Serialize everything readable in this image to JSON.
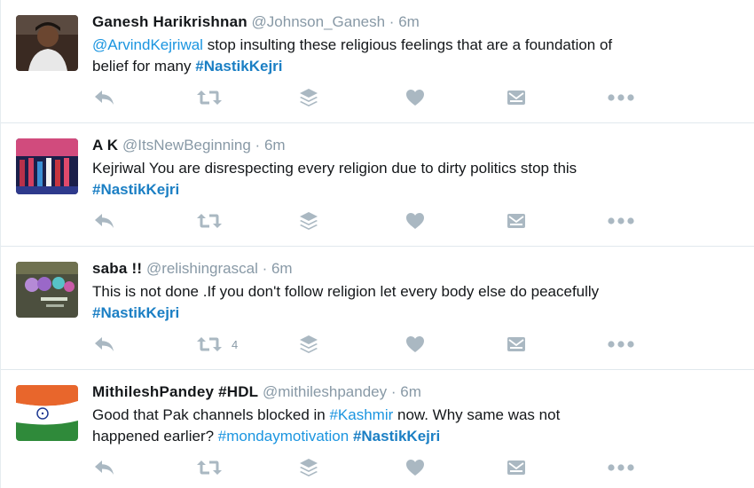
{
  "tweets": [
    {
      "name": "Ganesh Harikrishnan",
      "handle": "@Johnson_Ganesh",
      "time": "6m",
      "line1": [
        {
          "text": "@ArvindKejriwal",
          "type": "mention"
        },
        {
          "text": " stop insulting these religious feelings that are a foundation of",
          "type": "plain"
        }
      ],
      "line2": [
        {
          "text": "belief for many ",
          "type": "plain"
        },
        {
          "text": "#NastikKejri",
          "type": "hashtag-strong"
        }
      ],
      "retweet_count": ""
    },
    {
      "name": "A K",
      "handle": "@ItsNewBeginning",
      "time": "6m",
      "line1": [
        {
          "text": "Kejriwal You are disrespecting every religion due to dirty politics stop this",
          "type": "plain"
        }
      ],
      "line2": [
        {
          "text": "#NastikKejri",
          "type": "hashtag-strong"
        }
      ],
      "retweet_count": ""
    },
    {
      "name": "saba !!",
      "handle": "@relishingrascal",
      "time": "6m",
      "line1": [
        {
          "text": "This is not done .If you don't follow religion let every body else do peacefully",
          "type": "plain"
        }
      ],
      "line2": [
        {
          "text": "#NastikKejri",
          "type": "hashtag-strong"
        }
      ],
      "retweet_count": "4"
    },
    {
      "name": "MithileshPandey #HDL",
      "handle": "@mithileshpandey",
      "time": "6m",
      "line1": [
        {
          "text": "Good that Pak channels blocked in ",
          "type": "plain"
        },
        {
          "text": "#Kashmir",
          "type": "hashtag"
        },
        {
          "text": " now. Why same was not",
          "type": "plain"
        }
      ],
      "line2": [
        {
          "text": "happened earlier? ",
          "type": "plain"
        },
        {
          "text": "#mondaymotivation",
          "type": "hashtag"
        },
        {
          "text": " ",
          "type": "plain"
        },
        {
          "text": "#NastikKejri",
          "type": "hashtag-strong"
        }
      ],
      "retweet_count": ""
    }
  ],
  "separator": "·",
  "icons": [
    "reply-icon",
    "retweet-icon",
    "layers-icon",
    "like-icon",
    "dm-icon",
    "more-icon"
  ],
  "colors": {
    "link": "#1b95e0",
    "meta": "#8899a6",
    "icon": "#aab8c2"
  }
}
